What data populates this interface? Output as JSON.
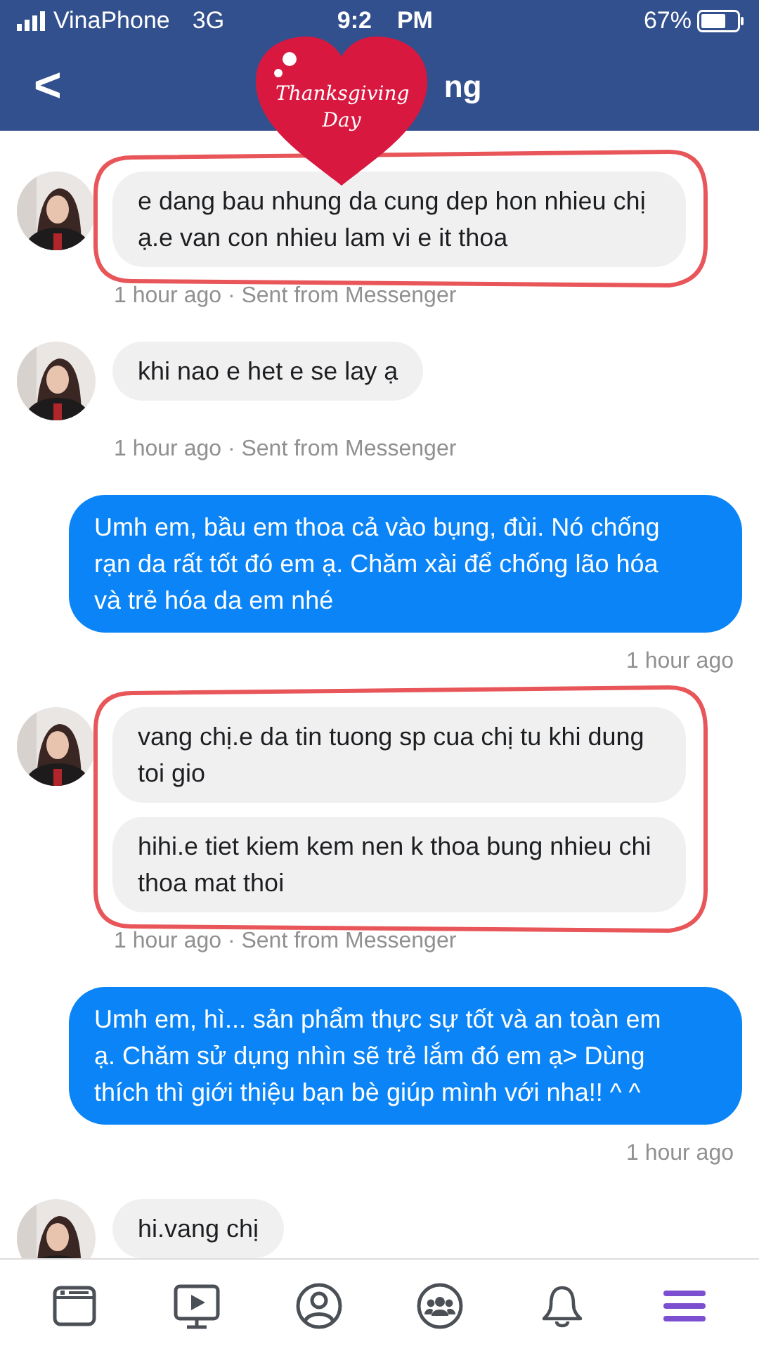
{
  "status_bar": {
    "carrier": "VinaPhone",
    "network": "3G",
    "time_visible": [
      "9:2",
      "PM"
    ],
    "battery": "67%"
  },
  "header": {
    "back": "<",
    "title": "ng"
  },
  "sticker": {
    "text": "Thanksgiving Day"
  },
  "messages": [
    {
      "kind": "received",
      "bubbles": [
        "e dang bau nhung da cung dep hon nhieu chị ạ.e van con nhieu lam vi e it thoa"
      ],
      "meta": "1 hour ago · Sent from Messenger",
      "circled": true
    },
    {
      "kind": "received",
      "bubbles": [
        "khi nao e het e se lay ạ"
      ],
      "meta": "1 hour ago · Sent from Messenger",
      "circled": false
    },
    {
      "kind": "sent",
      "bubbles": [
        "Umh em, bầu em thoa cả vào bụng, đùi. Nó chống rạn da rất tốt đó em ạ. Chăm xài để chống lão hóa và trẻ hóa da em nhé"
      ],
      "meta": "1 hour ago",
      "circled": false
    },
    {
      "kind": "received",
      "bubbles": [
        "vang chị.e da tin tuong sp cua chị tu khi dung toi gio",
        "hihi.e tiet kiem kem nen k thoa bung nhieu chi thoa mat thoi"
      ],
      "meta": "1 hour ago · Sent from Messenger",
      "circled": true
    },
    {
      "kind": "sent",
      "bubbles": [
        "Umh em, hì... sản phẩm thực sự tốt và an toàn em ạ. Chăm sử dụng nhìn sẽ trẻ lắm đó em ạ> Dùng thích thì giới thiệu bạn bè giúp mình với nha!! ^ ^"
      ],
      "meta": "1 hour ago",
      "circled": false
    },
    {
      "kind": "received",
      "bubbles": [
        "hi.vang chị"
      ],
      "circled": false
    }
  ],
  "tab_bar": [
    {
      "kind": "news",
      "selected": false
    },
    {
      "kind": "video",
      "selected": false
    },
    {
      "kind": "profile",
      "selected": false
    },
    {
      "kind": "groups",
      "selected": false
    },
    {
      "kind": "bell",
      "selected": false
    },
    {
      "kind": "menu",
      "selected": true
    }
  ]
}
